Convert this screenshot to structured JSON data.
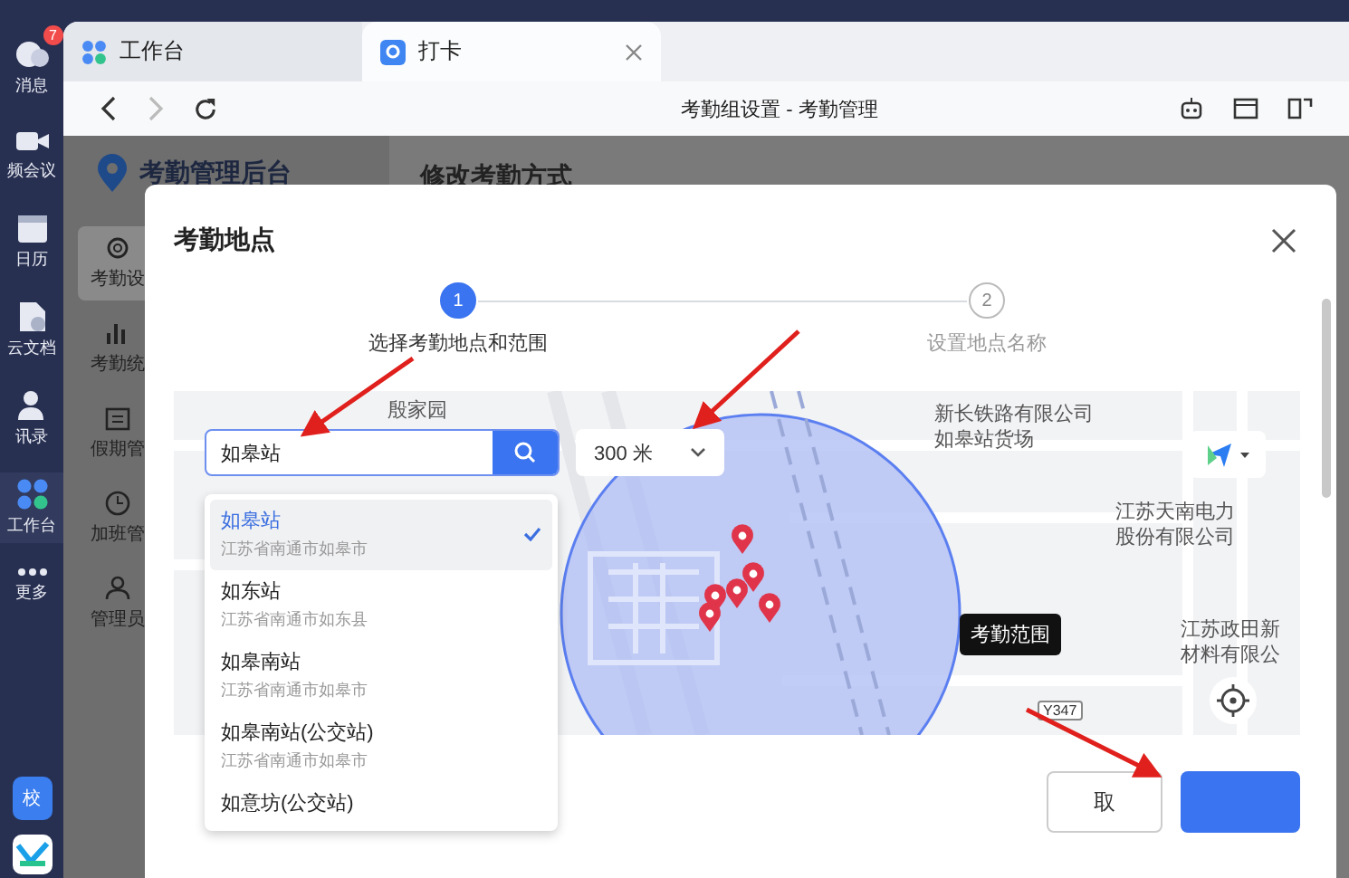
{
  "rail": {
    "items": [
      {
        "label": "消息",
        "kind": "chat",
        "badge": "7",
        "selected": false
      },
      {
        "label": "频会议",
        "kind": "video",
        "selected": false
      },
      {
        "label": "日历",
        "kind": "calendar",
        "selected": false
      },
      {
        "label": "云文档",
        "kind": "doc",
        "selected": false
      },
      {
        "label": "讯录",
        "kind": "contacts",
        "selected": false
      },
      {
        "label": "工作台",
        "kind": "apps",
        "selected": true
      },
      {
        "label": "更多",
        "kind": "more",
        "selected": false
      }
    ],
    "avatar": "校"
  },
  "tabs": [
    {
      "label": "工作台",
      "kind": "apps",
      "selected": false,
      "closable": false
    },
    {
      "label": "打卡",
      "kind": "pin",
      "selected": true,
      "closable": true
    }
  ],
  "page_title": "考勤组设置 - 考勤管理",
  "background": {
    "app_title": "考勤管理后台",
    "page_heading": "修改考勤方式",
    "menu": [
      {
        "label": "考勤设",
        "kind": "gear",
        "selected": true
      },
      {
        "label": "考勤统",
        "kind": "chart",
        "selected": false
      },
      {
        "label": "假期管",
        "kind": "calendar",
        "selected": false
      },
      {
        "label": "加班管",
        "kind": "clock",
        "selected": false
      },
      {
        "label": "管理员",
        "kind": "person",
        "selected": false
      }
    ]
  },
  "dialog": {
    "title": "考勤地点",
    "steps": [
      {
        "number": "1",
        "label": "选择考勤地点和范围",
        "active": true
      },
      {
        "number": "2",
        "label": "设置地点名称",
        "active": false
      }
    ],
    "search": {
      "value": "如皋站"
    },
    "radius": {
      "value": "300 米"
    },
    "results": [
      {
        "name": "如皋站",
        "address": "江苏省南通市如皋市",
        "selected": true
      },
      {
        "name": "如东站",
        "address": "江苏省南通市如东县",
        "selected": false
      },
      {
        "name": "如皋南站",
        "address": "江苏省南通市如皋市",
        "selected": false
      },
      {
        "name": "如皋南站(公交站)",
        "address": "江苏省南通市如皋市",
        "selected": false
      },
      {
        "name": "如意坊(公交站)",
        "selected": false
      }
    ],
    "map": {
      "labels": [
        "殷家园",
        "新长铁路有限公司",
        "如皋站货场",
        "江苏天南电力",
        "股份有限公司",
        "江苏政田新",
        "材料有限公"
      ],
      "road": "Y347",
      "range_label": "考勤范围"
    },
    "buttons": [
      {
        "kind": "secondary",
        "label": "取"
      },
      {
        "kind": "primary"
      }
    ]
  }
}
